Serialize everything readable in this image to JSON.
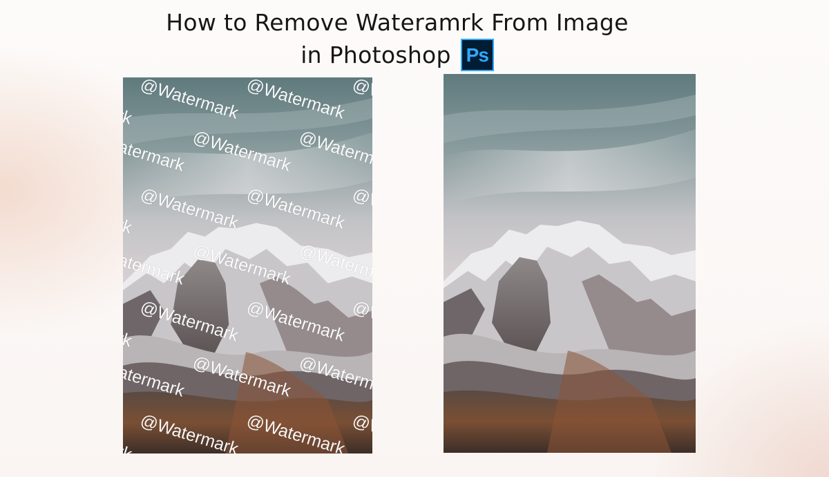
{
  "title": {
    "line1": "How to Remove Wateramrk From Image",
    "line2": "in Photoshop"
  },
  "photoshop_logo": {
    "text": "Ps",
    "icon": "photoshop-icon",
    "bg_color": "#001d34",
    "accent_color": "#31a8ff"
  },
  "left_image": {
    "description_icon": "mountain-photo-with-watermark",
    "watermark_text": "@Watermark"
  },
  "right_image": {
    "description_icon": "mountain-photo-clean"
  }
}
